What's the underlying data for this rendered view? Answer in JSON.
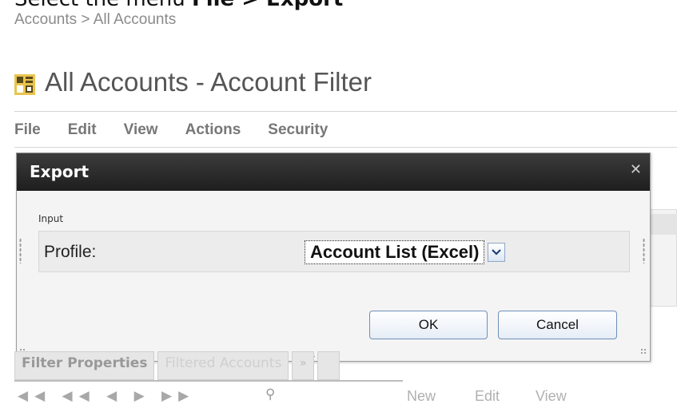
{
  "instruction": {
    "prefix": "Select the menu",
    "menu_path": "File > Export"
  },
  "breadcrumb": "Accounts > All Accounts",
  "page_title": "All Accounts - Account Filter",
  "menu": [
    "File",
    "Edit",
    "View",
    "Actions",
    "Security"
  ],
  "dialog": {
    "title": "Export",
    "close_glyph": "✕",
    "section_label": "Input",
    "profile_label": "Profile:",
    "profile_value": "Account List (Excel)",
    "ok_label": "OK",
    "cancel_label": "Cancel"
  },
  "tabs": {
    "filter_properties": "Filter Properties",
    "filtered_accounts": "Filtered Accounts",
    "more": "»"
  },
  "toolbar": {
    "nav_glyphs": "◀◀ ◀◀ ◀ ▶ ▶▶",
    "search_glyph": "⚲",
    "new": "New",
    "edit": "Edit",
    "view": "View"
  },
  "colors": {
    "dialog_header": "#2a2a2a",
    "button_border": "#6f8fb9",
    "background": "#ffffff"
  },
  "icons": {
    "title": "accounts-icon",
    "close": "close-icon",
    "dropdown": "chevron-down-icon",
    "search": "search-icon"
  }
}
